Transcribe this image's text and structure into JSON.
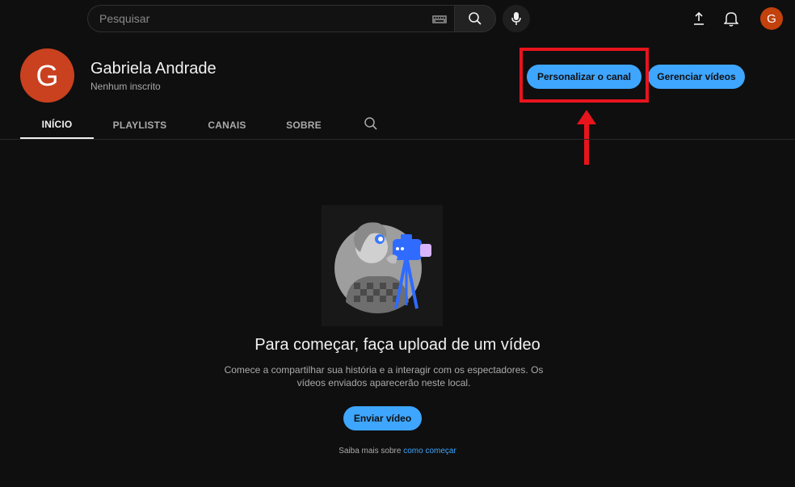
{
  "search": {
    "placeholder": "Pesquisar"
  },
  "header": {
    "avatar_letter": "G",
    "channel_avatar_letter": "G",
    "channel_name": "Gabriela Andrade",
    "subscribers": "Nenhum inscrito",
    "customize_label": "Personalizar o canal",
    "manage_label": "Gerenciar vídeos"
  },
  "tabs": [
    {
      "label": "INÍCIO",
      "active": true
    },
    {
      "label": "PLAYLISTS",
      "active": false
    },
    {
      "label": "CANAIS",
      "active": false
    },
    {
      "label": "SOBRE",
      "active": false
    }
  ],
  "empty_state": {
    "title": "Para começar, faça upload de um vídeo",
    "description": "Comece a compartilhar sua história e a interagir com os espectadores. Os vídeos enviados aparecerão neste local.",
    "upload_label": "Enviar vídeo",
    "learn_more_prefix": "Saiba mais sobre",
    "learn_more_link": "como começar"
  },
  "colors": {
    "background": "#0f0f0f",
    "accent": "#3ea6ff",
    "highlight": "#e8141c",
    "avatar": "#c9411f"
  },
  "icons": [
    "keyboard-icon",
    "search-icon",
    "mic-icon",
    "upload-icon",
    "bell-icon",
    "camera-operator-illustration"
  ]
}
